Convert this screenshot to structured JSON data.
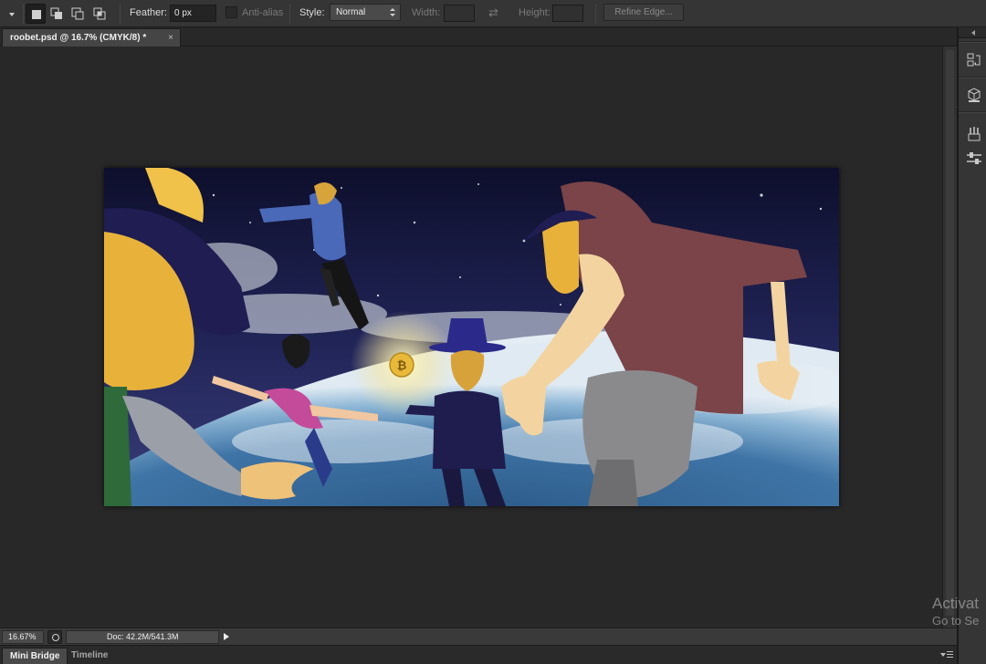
{
  "options_bar": {
    "tool_dropdown_icon": "marquee-preset-chevron-icon",
    "selection_modes": [
      "new-selection-icon",
      "add-to-selection-icon",
      "subtract-from-selection-icon",
      "intersect-selection-icon"
    ],
    "feather_label": "Feather:",
    "feather_value": "0 px",
    "antialias_label": "Anti-alias",
    "style_label": "Style:",
    "style_value": "Normal",
    "width_label": "Width:",
    "width_value": "",
    "swap_icon": "swap-dimensions-icon",
    "height_label": "Height:",
    "height_value": "",
    "refine_edge_label": "Refine Edge..."
  },
  "document_tab": {
    "title": "roobet.psd @ 16.7% (CMYK/8) *",
    "close_symbol": "×"
  },
  "status_bar": {
    "zoom": "16.67%",
    "doc_info": "Doc: 42.2M/541.3M"
  },
  "panel_tabs": [
    {
      "label": "Mini Bridge",
      "active": true
    },
    {
      "label": "Timeline",
      "active": false
    }
  ],
  "dock_icons": [
    "history-icon",
    "3d-cube-icon",
    "brushes-icon",
    "adjustments-icon"
  ],
  "watermark": {
    "line1": "Activat",
    "line2": "Go to Se"
  },
  "colors": {
    "chrome_dark": "#282828",
    "options_bar": "#353535",
    "space_sky": "#15163a",
    "earth_blue": "#3d6a99"
  }
}
